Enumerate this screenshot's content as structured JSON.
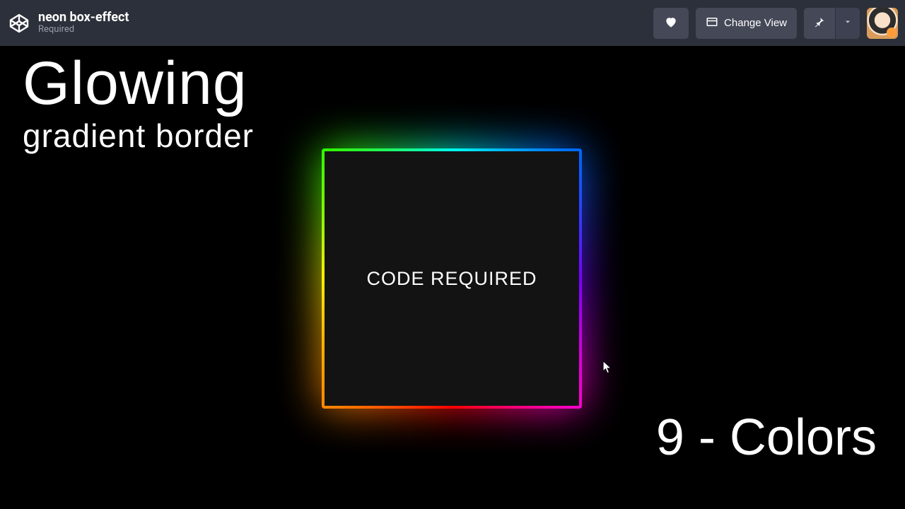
{
  "header": {
    "pen_title": "neon box-effect",
    "pen_author": "Required",
    "change_view_label": "Change View"
  },
  "overlay": {
    "title_line1": "Glowing",
    "title_line2": "gradient border",
    "footer": "9 - Colors"
  },
  "box": {
    "label": "CODE REQUIRED"
  },
  "icons": {
    "logo": "codepen-logo",
    "heart": "heart-icon",
    "view": "layout-icon",
    "pin": "pin-icon",
    "chevron": "chevron-down-icon"
  }
}
